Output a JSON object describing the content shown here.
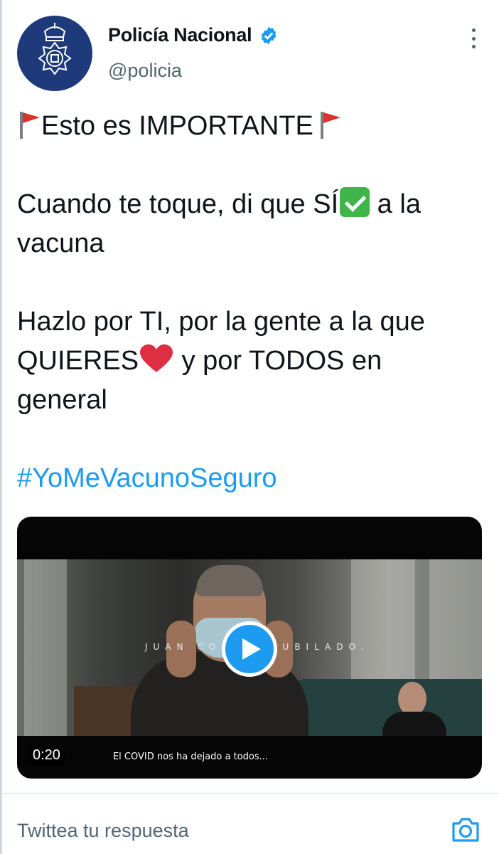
{
  "tweet": {
    "author": {
      "display_name": "Policía Nacional",
      "handle": "@policia",
      "verified": true,
      "verified_color": "#1d9bf0"
    },
    "line1": {
      "before_flag": "",
      "text": "Esto es IMPORTANTE",
      "flag_color": "#d8342c"
    },
    "line2": {
      "text_a": "Cuando te toque, di que SÍ",
      "text_b": " a la vacuna"
    },
    "line3": {
      "text_a": "Hazlo por TI, por la gente a la que QUIERES",
      "text_b": " y por TODOS en general"
    },
    "hashtag": "#YoMeVacunoSeguro",
    "hashtag_color": "#1d9bf0"
  },
  "video": {
    "caption_name": "JUAN CONT",
    "caption_role": "JUBILADO.",
    "timestamp": "0:20",
    "subtitle": "El COVID nos ha dejado a todos...",
    "play_icon": "play-icon"
  },
  "reply": {
    "placeholder": "Twittea tu respuesta",
    "camera_icon": "camera-icon"
  },
  "icons": {
    "more": "more-vertical-icon",
    "verified": "verified-badge-icon",
    "flag": "red-flag-icon",
    "check": "check-mark-icon",
    "heart": "red-heart-icon"
  }
}
